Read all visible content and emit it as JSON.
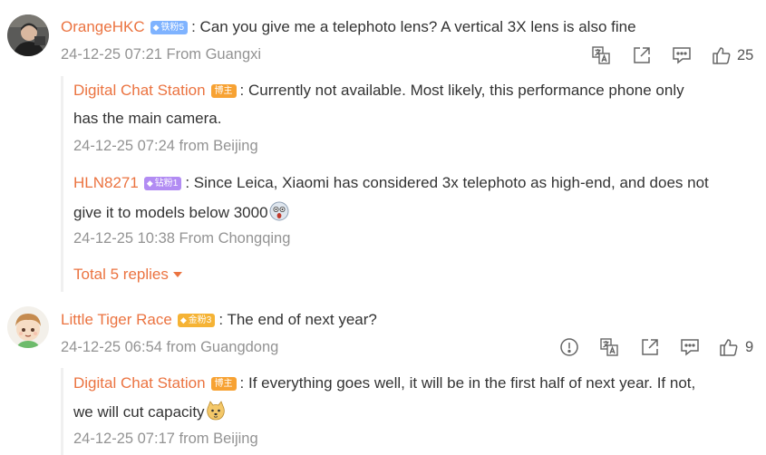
{
  "comments": [
    {
      "user": "OrangeHKC",
      "badge": "铁粉5",
      "text": ": Can you give me a telephoto lens? A vertical 3X lens is also fine",
      "meta": "24-12-25 07:21 From Guangxi",
      "likes": "25",
      "replies": [
        {
          "user": "Digital Chat Station",
          "badge": "博主",
          "text_line1": ": Currently not available. Most likely, this performance phone only",
          "text_line2": "has the main camera.",
          "meta": "24-12-25 07:24 from Beijing"
        },
        {
          "user": "HLN8271",
          "badge": "钻粉1",
          "text_line1": ": Since Leica, Xiaomi has considered 3x telephoto as high-end, and does not",
          "text_line2": "give it to models below 3000",
          "meta": "24-12-25 10:38 From Chongqing"
        }
      ],
      "more_replies": "Total 5 replies"
    },
    {
      "user": "Little Tiger Race",
      "badge": "金粉3",
      "text": ": The end of next year?",
      "meta": "24-12-25 06:54 from Guangdong",
      "likes": "9",
      "replies": [
        {
          "user": "Digital Chat Station",
          "badge": "博主",
          "text_line1": ": If everything goes well, it will be in the first half of next year. If not,",
          "text_line2": "we will cut capacity",
          "meta": "24-12-25 07:17 from Beijing"
        }
      ]
    }
  ],
  "icons": {
    "translate": "translate-icon",
    "share": "share-icon",
    "comment": "comment-icon",
    "like": "thumbs-up-icon",
    "report": "report-icon"
  },
  "colors": {
    "username": "#eb7340",
    "meta": "#939393",
    "badge_host": "#f7a233"
  }
}
